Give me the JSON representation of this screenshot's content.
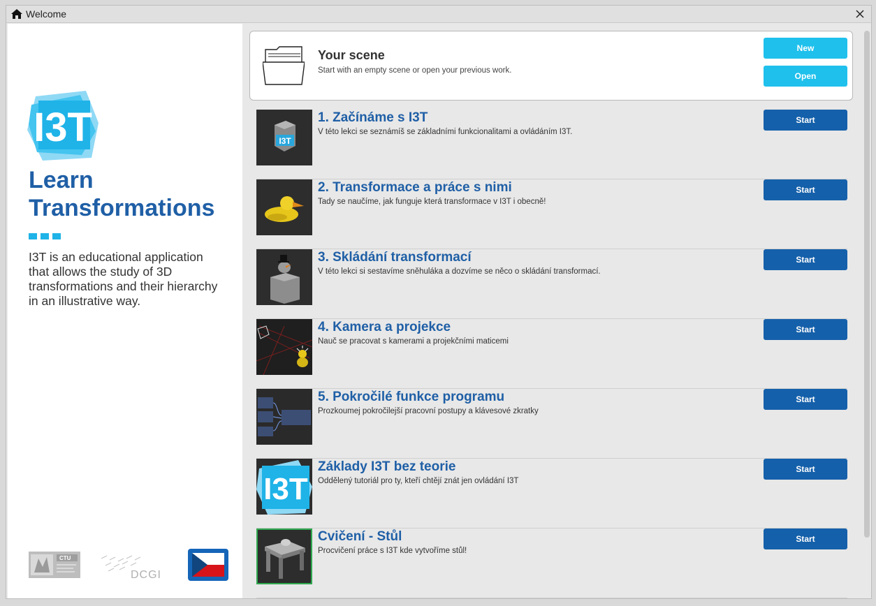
{
  "window": {
    "title": "Welcome"
  },
  "sidebar": {
    "logo_text": "I3T",
    "title_line1": "Learn",
    "title_line2": "Transformations",
    "intro": "I3T is an educational application that allows the study of 3D transformations and their hierarchy in an illustrative way.",
    "ctu_badge": "CTU",
    "dcgi_text": "DCGI"
  },
  "scene": {
    "title": "Your scene",
    "subtitle": "Start with an empty scene or open your previous work.",
    "new_label": "New",
    "open_label": "Open"
  },
  "lessons": [
    {
      "title": "1. Začínáme s I3T",
      "desc": "V této lekci se seznámíš se základními funkcionalitami a ovládáním I3T.",
      "button": "Start",
      "thumb": "cube-with-i3t-logo"
    },
    {
      "title": "2. Transformace a práce s nimi",
      "desc": "Tady se naučíme, jak funguje která transformace v I3T i obecně!",
      "button": "Start",
      "thumb": "yellow-duck"
    },
    {
      "title": "3. Skládání transformací",
      "desc": "V této lekci si sestavíme sněhuláka a dozvíme se něco o skládání transformací.",
      "button": "Start",
      "thumb": "snowman-on-cube"
    },
    {
      "title": "4. Kamera a projekce",
      "desc": "Nauč se pracovat s kamerami a projekčními maticemi",
      "button": "Start",
      "thumb": "camera-frustum"
    },
    {
      "title": "5. Pokročilé funkce programu",
      "desc": "Prozkoumej pokročilejší pracovní postupy a klávesové zkratky",
      "button": "Start",
      "thumb": "node-graph"
    },
    {
      "title": "Základy I3T bez teorie",
      "desc": "Oddělený tutoriál pro ty, kteří chtějí znát jen ovládání I3T",
      "button": "Start",
      "thumb": "i3t-logo"
    },
    {
      "title": "Cvičení - Stůl",
      "desc": "Procvičení práce s I3T kde vytvoříme stůl!",
      "button": "Start",
      "thumb": "table-with-teapot"
    }
  ],
  "colors": {
    "accent_blue": "#1560aa",
    "title_blue": "#1f5fa6",
    "cyan": "#1fc0ec"
  }
}
